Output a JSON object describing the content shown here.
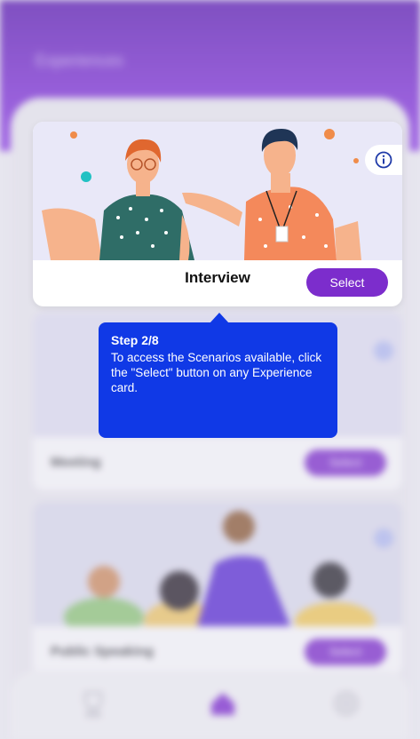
{
  "header": {
    "title": "Experiences"
  },
  "active_card": {
    "title": "Interview",
    "select_label": "Select",
    "info_icon": "info-icon"
  },
  "tooltip": {
    "step": "Step 2/8",
    "text": "To access the Scenarios available, click the \"Select\" button on any Experience card."
  },
  "background_cards": [
    {
      "title": "Meeting",
      "select_label": "Select"
    },
    {
      "title": "Public Speaking",
      "select_label": "Select"
    }
  ],
  "tab_bar": {
    "tabs": [
      {
        "icon": "trophy-icon"
      },
      {
        "icon": "home-icon"
      },
      {
        "icon": "settings-icon"
      }
    ]
  },
  "colors": {
    "header": "#6a25c4",
    "accent": "#7c2dcc",
    "tooltip": "#1039e6"
  }
}
